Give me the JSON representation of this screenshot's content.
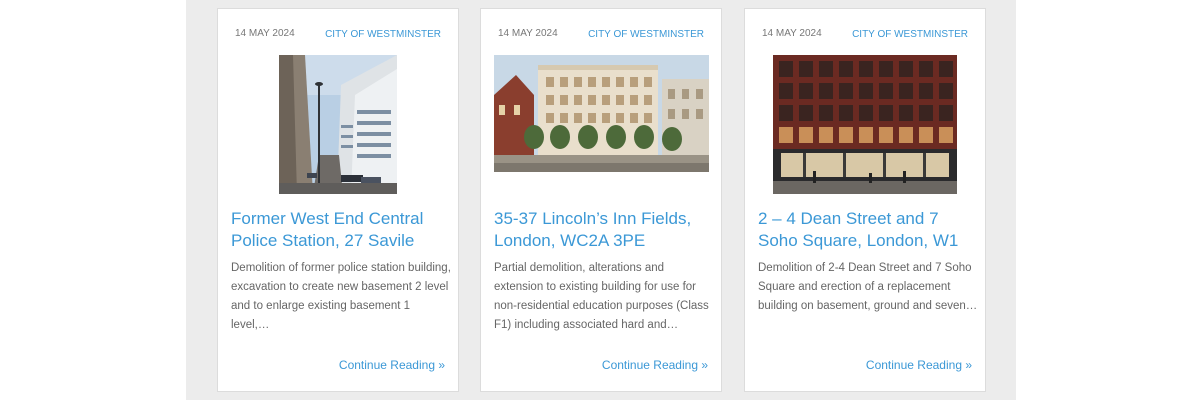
{
  "colors": {
    "accent": "#3b98d6",
    "text": "#666666",
    "meta": "#777777",
    "backdrop": "#ececec"
  },
  "posts": [
    {
      "date": "14 MAY 2024",
      "category": "CITY OF WESTMINSTER",
      "title": "Former West End Central Police Station, 27 Savile",
      "excerpt": "Demolition of former police station building, excavation to create new basement 2 level and to enlarge existing basement 1 level,…",
      "more": "Continue Reading »"
    },
    {
      "date": "14 MAY 2024",
      "category": "CITY OF WESTMINSTER",
      "title": "35-37 Lincoln’s Inn Fields, London, WC2A 3PE",
      "excerpt": "Partial demolition, alterations and extension to existing building for use for non-residential education purposes (Class F1) including associated hard and…",
      "more": "Continue Reading »"
    },
    {
      "date": "14 MAY 2024",
      "category": "CITY OF WESTMINSTER",
      "title": "2 – 4 Dean Street and 7 Soho Square, London, W1",
      "excerpt": "Demolition of 2-4 Dean Street and 7 Soho Square and erection of a replacement building on basement, ground and seven…",
      "more": "Continue Reading »"
    }
  ]
}
